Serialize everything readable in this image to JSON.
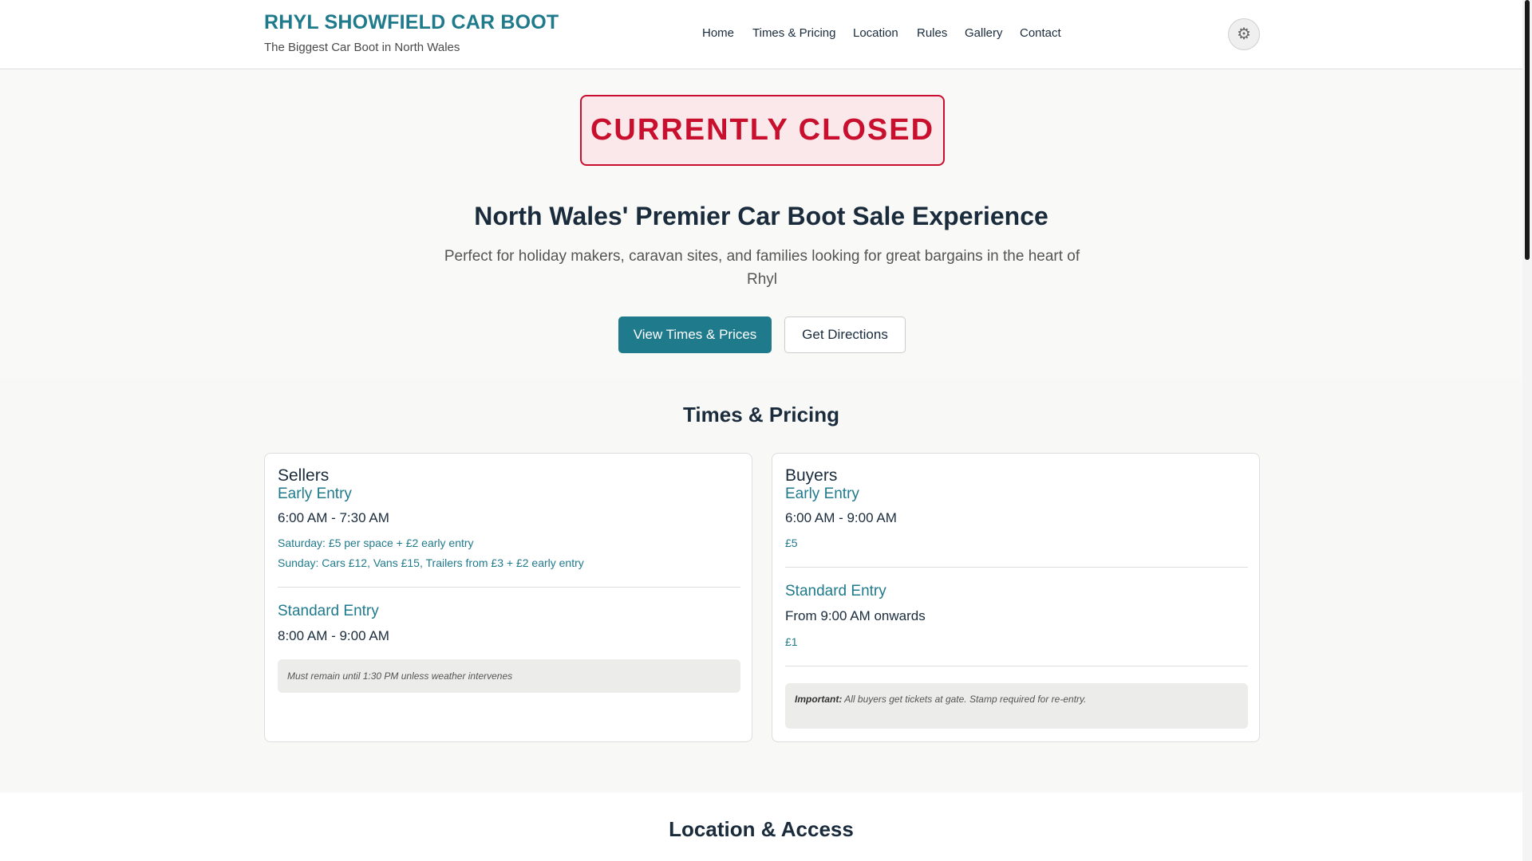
{
  "header": {
    "title": "RHYL SHOWFIELD CAR BOOT",
    "tagline": "The Biggest Car Boot in North Wales",
    "theme_icon": "gear-icon",
    "theme_glyph": "⚙"
  },
  "nav": {
    "items": [
      {
        "label": "Home"
      },
      {
        "label": "Times & Pricing"
      },
      {
        "label": "Location"
      },
      {
        "label": "Rules"
      },
      {
        "label": "Gallery"
      },
      {
        "label": "Contact"
      }
    ]
  },
  "hero": {
    "status": "CURRENTLY CLOSED",
    "heading": "North Wales' Premier Car Boot Sale Experience",
    "subheading": "Perfect for holiday makers, caravan sites, and families looking for great bargains in the heart of Rhyl",
    "primary_button": "View Times & Prices",
    "secondary_button": "Get Directions"
  },
  "pricing": {
    "title": "Times & Pricing",
    "sellers": {
      "title": "Sellers",
      "early_label": "Early Entry",
      "early_time": "6:00 AM - 7:30 AM",
      "early_price_saturday": "Saturday: £5 per space + £2 early entry",
      "early_price_sunday": "Sunday: Cars £12, Vans £15, Trailers from £3 + £2 early entry",
      "standard_label": "Standard Entry",
      "standard_time": "8:00 AM - 9:00 AM",
      "note": "Must remain until 1:30 PM unless weather intervenes"
    },
    "buyers": {
      "title": "Buyers",
      "early_label": "Early Entry",
      "early_time": "6:00 AM - 9:00 AM",
      "early_price": "£5",
      "standard_label": "Standard Entry",
      "standard_time": "From 9:00 AM onwards",
      "standard_price": "£1",
      "note_label": "Important:",
      "note": "All buyers get tickets at gate. Stamp required for re-entry."
    }
  },
  "location": {
    "title": "Location & Access"
  },
  "colors": {
    "brand": "#1f7a8c",
    "closed": "#c8102e"
  }
}
